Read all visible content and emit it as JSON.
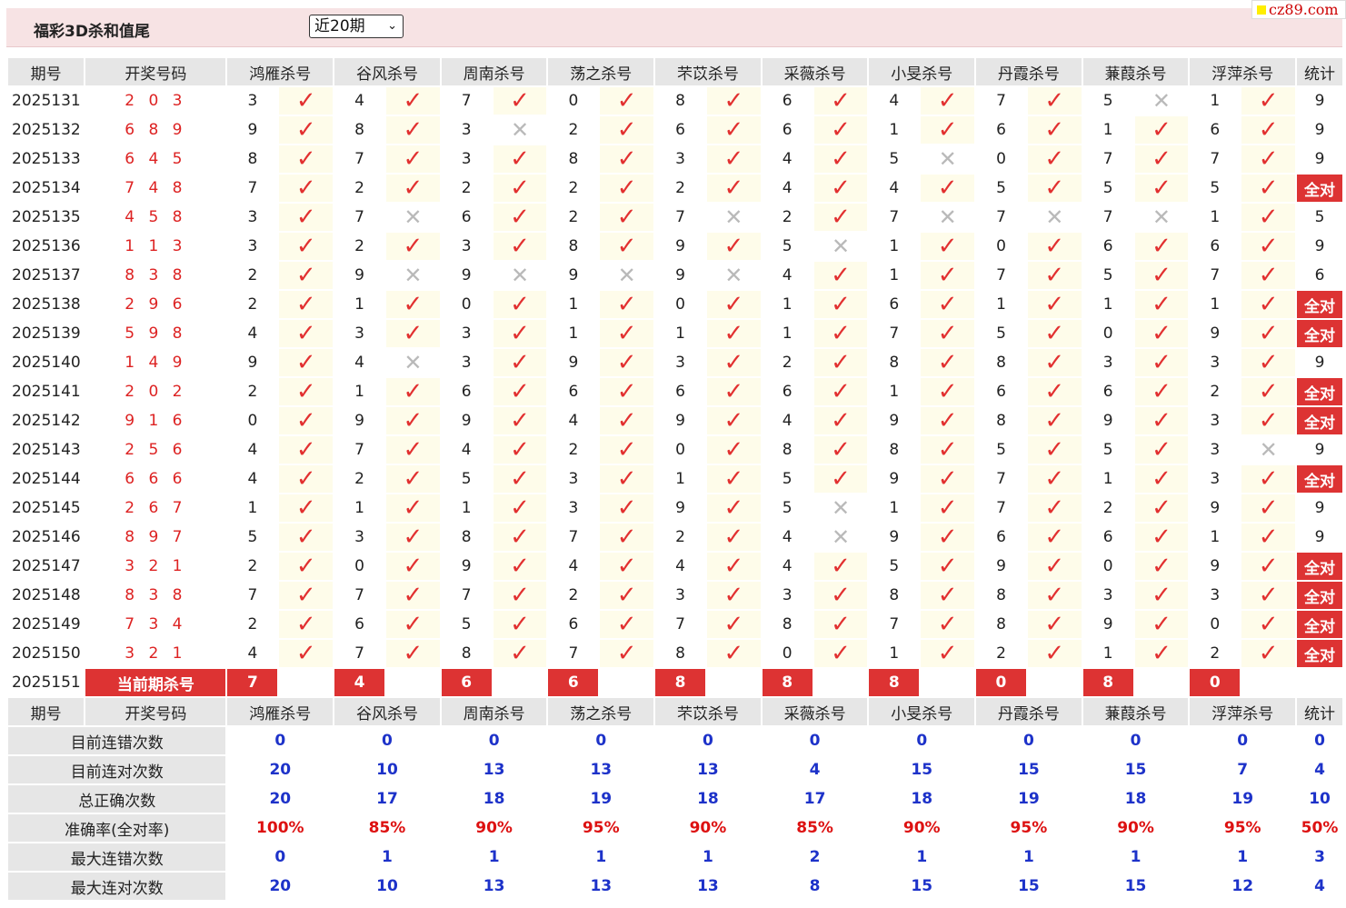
{
  "header": {
    "title": "福彩3D杀和值尾",
    "select_value": "近20期",
    "logo_text": "cz89.com"
  },
  "columns": {
    "period": "期号",
    "draw": "开奖号码",
    "experts": [
      "鸿雁杀号",
      "谷风杀号",
      "周南杀号",
      "荡之杀号",
      "芣苡杀号",
      "采薇杀号",
      "小旻杀号",
      "丹霞杀号",
      "蒹葭杀号",
      "浮萍杀号"
    ],
    "stat": "统计"
  },
  "rows": [
    {
      "period": "2025131",
      "draw": "2 0 3",
      "kills": [
        3,
        4,
        7,
        0,
        8,
        6,
        4,
        7,
        5,
        1
      ],
      "results": [
        1,
        1,
        1,
        1,
        1,
        1,
        1,
        1,
        0,
        1
      ],
      "stat": "9"
    },
    {
      "period": "2025132",
      "draw": "6 8 9",
      "kills": [
        9,
        8,
        3,
        2,
        6,
        6,
        1,
        6,
        1,
        6
      ],
      "results": [
        1,
        1,
        0,
        1,
        1,
        1,
        1,
        1,
        1,
        1
      ],
      "stat": "9"
    },
    {
      "period": "2025133",
      "draw": "6 4 5",
      "kills": [
        8,
        7,
        3,
        8,
        3,
        4,
        5,
        0,
        7,
        7
      ],
      "results": [
        1,
        1,
        1,
        1,
        1,
        1,
        0,
        1,
        1,
        1
      ],
      "stat": "9"
    },
    {
      "period": "2025134",
      "draw": "7 4 8",
      "kills": [
        7,
        2,
        2,
        2,
        2,
        4,
        4,
        5,
        5,
        5
      ],
      "results": [
        1,
        1,
        1,
        1,
        1,
        1,
        1,
        1,
        1,
        1
      ],
      "stat": "全对"
    },
    {
      "period": "2025135",
      "draw": "4 5 8",
      "kills": [
        3,
        7,
        6,
        2,
        7,
        2,
        7,
        7,
        7,
        1
      ],
      "results": [
        1,
        0,
        1,
        1,
        0,
        1,
        0,
        0,
        0,
        1
      ],
      "stat": "5"
    },
    {
      "period": "2025136",
      "draw": "1 1 3",
      "kills": [
        3,
        2,
        3,
        8,
        9,
        5,
        1,
        0,
        6,
        6
      ],
      "results": [
        1,
        1,
        1,
        1,
        1,
        0,
        1,
        1,
        1,
        1
      ],
      "stat": "9"
    },
    {
      "period": "2025137",
      "draw": "8 3 8",
      "kills": [
        2,
        9,
        9,
        9,
        9,
        4,
        1,
        7,
        5,
        7
      ],
      "results": [
        1,
        0,
        0,
        0,
        0,
        1,
        1,
        1,
        1,
        1
      ],
      "stat": "6"
    },
    {
      "period": "2025138",
      "draw": "2 9 6",
      "kills": [
        2,
        1,
        0,
        1,
        0,
        1,
        6,
        1,
        1,
        1
      ],
      "results": [
        1,
        1,
        1,
        1,
        1,
        1,
        1,
        1,
        1,
        1
      ],
      "stat": "全对"
    },
    {
      "period": "2025139",
      "draw": "5 9 8",
      "kills": [
        4,
        3,
        3,
        1,
        1,
        1,
        7,
        5,
        0,
        9
      ],
      "results": [
        1,
        1,
        1,
        1,
        1,
        1,
        1,
        1,
        1,
        1
      ],
      "stat": "全对"
    },
    {
      "period": "2025140",
      "draw": "1 4 9",
      "kills": [
        9,
        4,
        3,
        9,
        3,
        2,
        8,
        8,
        3,
        3
      ],
      "results": [
        1,
        0,
        1,
        1,
        1,
        1,
        1,
        1,
        1,
        1
      ],
      "stat": "9"
    },
    {
      "period": "2025141",
      "draw": "2 0 2",
      "kills": [
        2,
        1,
        6,
        6,
        6,
        6,
        1,
        6,
        6,
        2
      ],
      "results": [
        1,
        1,
        1,
        1,
        1,
        1,
        1,
        1,
        1,
        1
      ],
      "stat": "全对"
    },
    {
      "period": "2025142",
      "draw": "9 1 6",
      "kills": [
        0,
        9,
        9,
        4,
        9,
        4,
        9,
        8,
        9,
        3
      ],
      "results": [
        1,
        1,
        1,
        1,
        1,
        1,
        1,
        1,
        1,
        1
      ],
      "stat": "全对"
    },
    {
      "period": "2025143",
      "draw": "2 5 6",
      "kills": [
        4,
        7,
        4,
        2,
        0,
        8,
        8,
        5,
        5,
        3
      ],
      "results": [
        1,
        1,
        1,
        1,
        1,
        1,
        1,
        1,
        1,
        0
      ],
      "stat": "9"
    },
    {
      "period": "2025144",
      "draw": "6 6 6",
      "kills": [
        4,
        2,
        5,
        3,
        1,
        5,
        9,
        7,
        1,
        3
      ],
      "results": [
        1,
        1,
        1,
        1,
        1,
        1,
        1,
        1,
        1,
        1
      ],
      "stat": "全对"
    },
    {
      "period": "2025145",
      "draw": "2 6 7",
      "kills": [
        1,
        1,
        1,
        3,
        9,
        5,
        1,
        7,
        2,
        9
      ],
      "results": [
        1,
        1,
        1,
        1,
        1,
        0,
        1,
        1,
        1,
        1
      ],
      "stat": "9"
    },
    {
      "period": "2025146",
      "draw": "8 9 7",
      "kills": [
        5,
        3,
        8,
        7,
        2,
        4,
        9,
        6,
        6,
        1
      ],
      "results": [
        1,
        1,
        1,
        1,
        1,
        0,
        1,
        1,
        1,
        1
      ],
      "stat": "9"
    },
    {
      "period": "2025147",
      "draw": "3 2 1",
      "kills": [
        2,
        0,
        9,
        4,
        4,
        4,
        5,
        9,
        0,
        9
      ],
      "results": [
        1,
        1,
        1,
        1,
        1,
        1,
        1,
        1,
        1,
        1
      ],
      "stat": "全对"
    },
    {
      "period": "2025148",
      "draw": "8 3 8",
      "kills": [
        7,
        7,
        7,
        2,
        3,
        3,
        8,
        8,
        3,
        3
      ],
      "results": [
        1,
        1,
        1,
        1,
        1,
        1,
        1,
        1,
        1,
        1
      ],
      "stat": "全对"
    },
    {
      "period": "2025149",
      "draw": "7 3 4",
      "kills": [
        2,
        6,
        5,
        6,
        7,
        8,
        7,
        8,
        9,
        0
      ],
      "results": [
        1,
        1,
        1,
        1,
        1,
        1,
        1,
        1,
        1,
        1
      ],
      "stat": "全对"
    },
    {
      "period": "2025150",
      "draw": "3 2 1",
      "kills": [
        4,
        7,
        8,
        7,
        8,
        0,
        1,
        2,
        1,
        2
      ],
      "results": [
        1,
        1,
        1,
        1,
        1,
        1,
        1,
        1,
        1,
        1
      ],
      "stat": "全对"
    }
  ],
  "current": {
    "period": "2025151",
    "label": "当前期杀号",
    "kills": [
      7,
      4,
      6,
      6,
      8,
      8,
      8,
      0,
      8,
      0
    ]
  },
  "summary": [
    {
      "label": "目前连错次数",
      "values": [
        "0",
        "0",
        "0",
        "0",
        "0",
        "0",
        "0",
        "0",
        "0",
        "0",
        "0"
      ],
      "red": false
    },
    {
      "label": "目前连对次数",
      "values": [
        "20",
        "10",
        "13",
        "13",
        "13",
        "4",
        "15",
        "15",
        "15",
        "7",
        "4"
      ],
      "red": false
    },
    {
      "label": "总正确次数",
      "values": [
        "20",
        "17",
        "18",
        "19",
        "18",
        "17",
        "18",
        "19",
        "18",
        "19",
        "10"
      ],
      "red": false
    },
    {
      "label": "准确率(全对率)",
      "values": [
        "100%",
        "85%",
        "90%",
        "95%",
        "90%",
        "85%",
        "90%",
        "95%",
        "90%",
        "95%",
        "50%"
      ],
      "red": true
    },
    {
      "label": "最大连错次数",
      "values": [
        "0",
        "1",
        "1",
        "1",
        "1",
        "2",
        "1",
        "1",
        "1",
        "1",
        "3"
      ],
      "red": false
    },
    {
      "label": "最大连对次数",
      "values": [
        "20",
        "10",
        "13",
        "13",
        "13",
        "8",
        "15",
        "15",
        "15",
        "12",
        "4"
      ],
      "red": false
    }
  ],
  "icons": {
    "hit": "checkmark-icon",
    "miss": "cross-icon"
  },
  "colors": {
    "accent_red": "#d33333",
    "check_red": "#e23030",
    "stat_blue": "#1d32c9",
    "header_bg": "#f7e3e4",
    "check_cell_bg": "#fefcea"
  }
}
